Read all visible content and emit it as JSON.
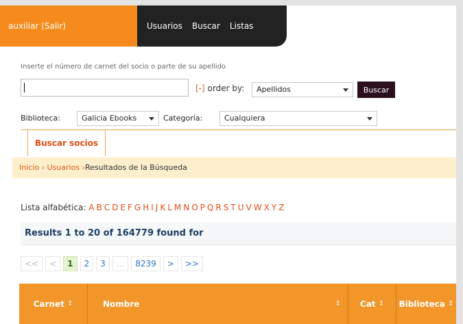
{
  "header": {
    "login_text": "auxiliar (Salir)",
    "nav": [
      "Usuarios",
      "Buscar",
      "Listas"
    ]
  },
  "search": {
    "hint": "Inserte el número de carnet del socio o parte de su apellido",
    "input_value": "",
    "toggle": "[-]",
    "order_label": "order by:",
    "order_value": "Apellidos",
    "button": "Buscar"
  },
  "filters": {
    "biblioteca_label": "Biblioteca:",
    "biblioteca_value": "Galicia Ebooks",
    "categoria_label": "Categoría:",
    "categoria_value": "Cualquiera"
  },
  "tab": {
    "active": "Buscar socios"
  },
  "breadcrumb": {
    "items": [
      "Inicio",
      "Usuarios",
      "Resultados de la Búsqueda"
    ],
    "sep": "›"
  },
  "alphabet": {
    "label": "Lista alfabética:",
    "letters": [
      "A",
      "B",
      "C",
      "D",
      "E",
      "F",
      "G",
      "H",
      "I",
      "J",
      "K",
      "L",
      "M",
      "N",
      "O",
      "P",
      "Q",
      "R",
      "S",
      "T",
      "U",
      "V",
      "W",
      "X",
      "Y",
      "Z"
    ]
  },
  "results": {
    "text": "Results 1 to 20 of 164779 found for"
  },
  "pagination": {
    "first": "<<",
    "prev": "<",
    "pages": [
      "1",
      "2",
      "3"
    ],
    "ellipsis": "...",
    "last_page": "8239",
    "next": ">",
    "last": ">>"
  },
  "table": {
    "columns": [
      "Carnet",
      "Nombre",
      "Cat",
      "Biblioteca"
    ],
    "sort_icon": "↕"
  },
  "colors": {
    "accent_orange": "#f48b1c",
    "header_dark": "#222222",
    "link_red": "#e34d12",
    "buscar_button": "#2b0f1d"
  }
}
